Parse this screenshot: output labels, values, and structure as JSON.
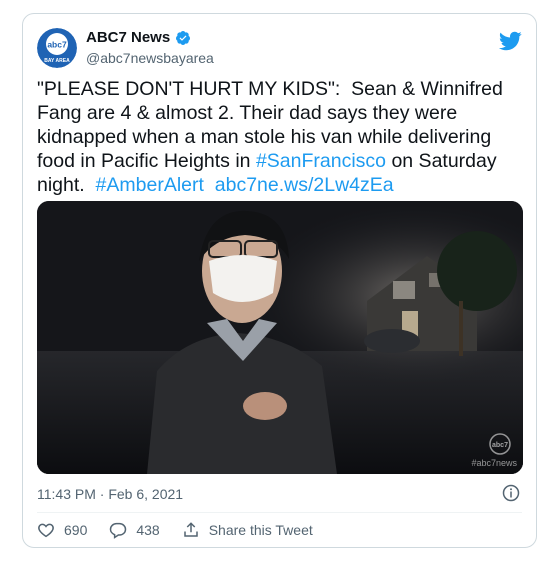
{
  "tweet": {
    "author": {
      "display_name": "ABC7 News",
      "handle": "@abc7newsbayarea",
      "avatar_text_top": "abc7",
      "avatar_text_bottom": "BAY AREA",
      "verified": true,
      "verified_color": "#1d9bf0"
    },
    "text_parts": {
      "p1": "\"PLEASE DON'T HURT MY KIDS\":  Sean & Winnifred Fang are 4 & almost 2. Their dad says they were kidnapped when a man stole his van while delivering food in Pacific Heights in ",
      "hashtag_sf": "#SanFrancisco",
      "p2": " on Saturday night.  ",
      "hashtag_amber": "#AmberAlert",
      "p3": "  ",
      "link": "abc7ne.ws/2Lw4zEa"
    },
    "media": {
      "watermark": "#abc7news",
      "watermark_logo": "abc7"
    },
    "timestamp": "11:43 PM · Feb 6, 2021",
    "likes": "690",
    "replies": "438",
    "share_label": "Share this Tweet"
  },
  "colors": {
    "link": "#1d9bf0",
    "brand_twitter": "#1d9bf0",
    "avatar_bg": "#1f63b4",
    "secondary_text": "#536471",
    "border": "#cfd9de"
  },
  "icons": [
    "abc7-logo",
    "verified-badge-icon",
    "twitter-bird-icon",
    "info-icon",
    "heart-icon",
    "reply-icon",
    "share-icon"
  ]
}
